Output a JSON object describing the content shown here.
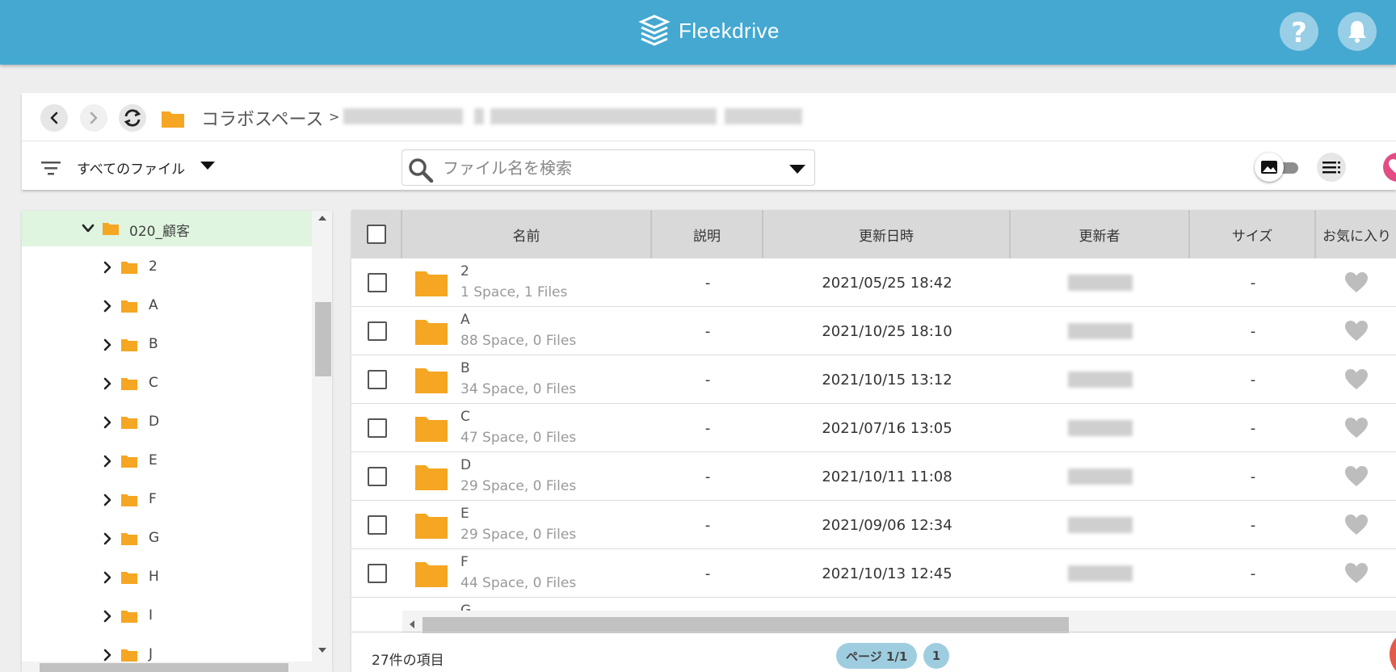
{
  "header": {
    "brand": "Fleekdrive",
    "help_icon": "question-icon",
    "notification_icon": "bell-icon"
  },
  "breadcrumb": {
    "root": "コラボスペース",
    "separator": ">"
  },
  "filter": {
    "label": "すべてのファイル"
  },
  "search": {
    "placeholder": "ファイル名を検索"
  },
  "tree": {
    "selected": "020_顧客",
    "items": [
      "2",
      "A",
      "B",
      "C",
      "D",
      "E",
      "F",
      "G",
      "H",
      "I",
      "J"
    ]
  },
  "table": {
    "columns": [
      "名前",
      "説明",
      "更新日時",
      "更新者",
      "サイズ",
      "お気に入り"
    ],
    "rows": [
      {
        "name": "2",
        "meta": "1 Space, 1 Files",
        "description": "-",
        "updated": "2021/05/25 18:42",
        "size": "-"
      },
      {
        "name": "A",
        "meta": "88 Space, 0 Files",
        "description": "-",
        "updated": "2021/10/25 18:10",
        "size": "-"
      },
      {
        "name": "B",
        "meta": "34 Space, 0 Files",
        "description": "-",
        "updated": "2021/10/15 13:12",
        "size": "-"
      },
      {
        "name": "C",
        "meta": "47 Space, 0 Files",
        "description": "-",
        "updated": "2021/07/16 13:05",
        "size": "-"
      },
      {
        "name": "D",
        "meta": "29 Space, 0 Files",
        "description": "-",
        "updated": "2021/10/11 11:08",
        "size": "-"
      },
      {
        "name": "E",
        "meta": "29 Space, 0 Files",
        "description": "-",
        "updated": "2021/09/06 12:34",
        "size": "-"
      },
      {
        "name": "F",
        "meta": "44 Space, 0 Files",
        "description": "-",
        "updated": "2021/10/13 12:45",
        "size": "-"
      }
    ],
    "partial_next": "G"
  },
  "footer": {
    "count": "27件の項目",
    "page_label": "ページ 1/1",
    "page_number": "1"
  },
  "colors": {
    "topbar": "#44a8d1",
    "folder": "#f5a623",
    "tree_selected": "#dff5e0",
    "favorite_button": "#e24d86"
  }
}
